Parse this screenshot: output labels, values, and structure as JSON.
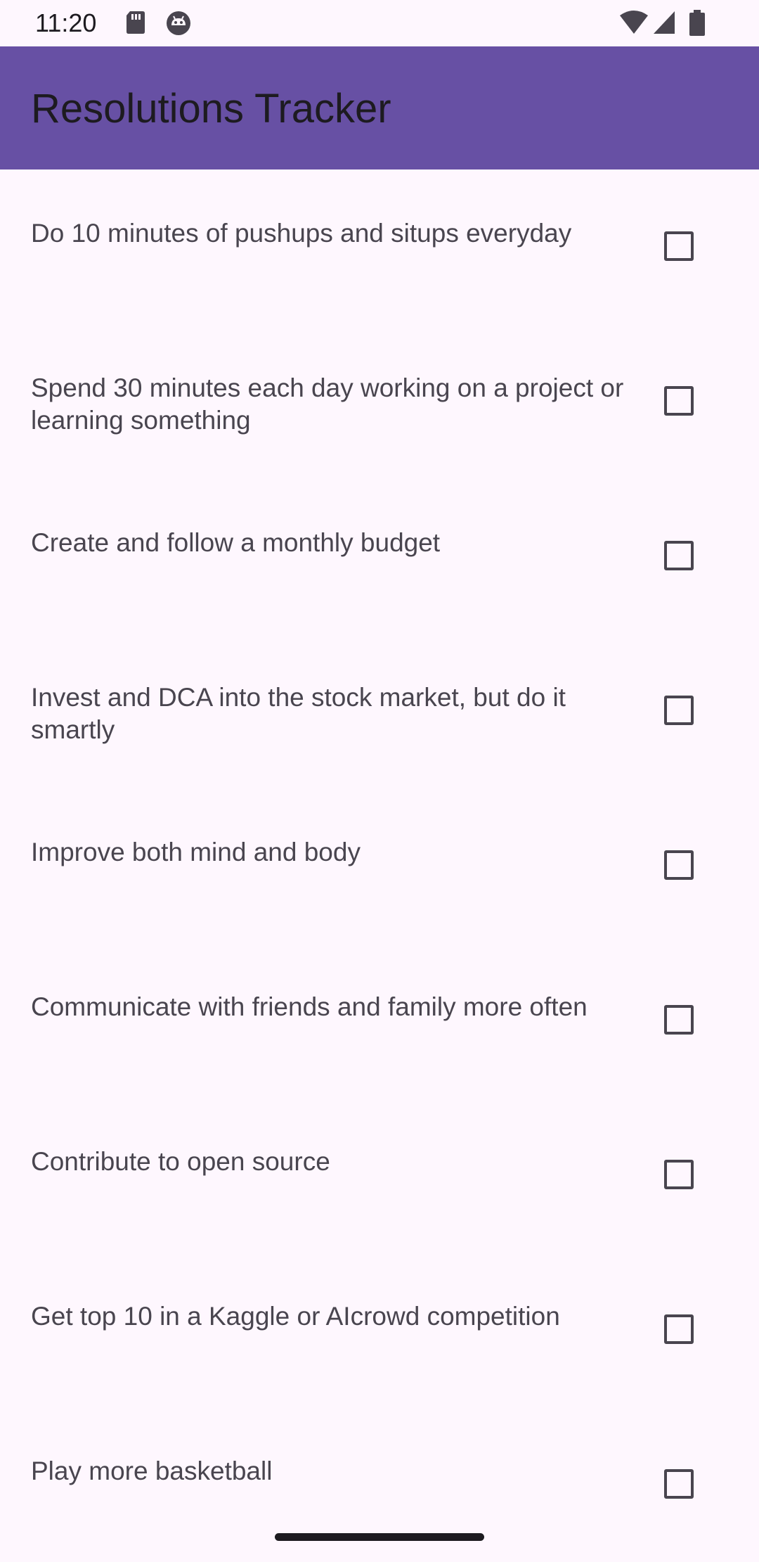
{
  "status_bar": {
    "time": "11:20",
    "icons": [
      "sd-card-icon",
      "android-debug-icon",
      "wifi-icon",
      "signal-icon",
      "battery-icon"
    ]
  },
  "app_bar": {
    "title": "Resolutions Tracker",
    "color": "#6750a4"
  },
  "resolutions": [
    {
      "label": "Do 10 minutes of pushups and situps everyday",
      "checked": false
    },
    {
      "label": "Spend 30 minutes each day working on a project or learning something",
      "checked": false
    },
    {
      "label": "Create and follow a monthly budget",
      "checked": false
    },
    {
      "label": "Invest and DCA into the stock market, but do it smartly",
      "checked": false
    },
    {
      "label": "Improve both mind and body",
      "checked": false
    },
    {
      "label": "Communicate with friends and family more often",
      "checked": false
    },
    {
      "label": "Contribute to open source",
      "checked": false
    },
    {
      "label": "Get top 10 in a Kaggle or AIcrowd competition",
      "checked": false
    },
    {
      "label": "Play more basketball",
      "checked": false
    }
  ],
  "colors": {
    "background": "#fef7fe",
    "text_secondary": "#49454f",
    "text_primary": "#1d1b20"
  }
}
